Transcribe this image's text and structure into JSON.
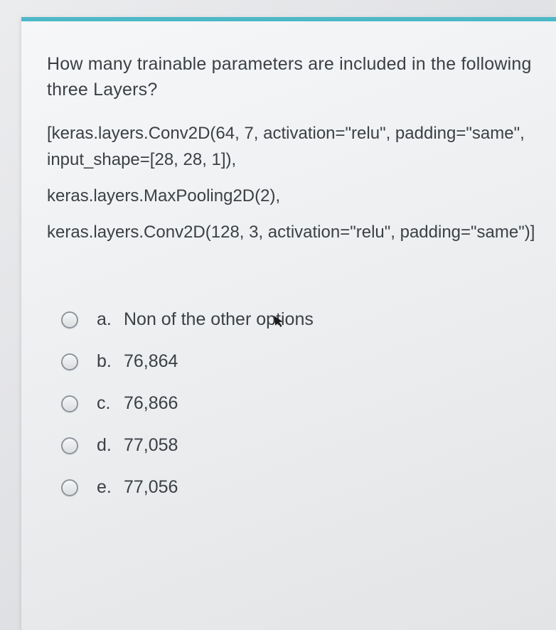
{
  "question": {
    "prompt": "How many trainable parameters are included in the following three Layers?",
    "code_lines": [
      "[keras.layers.Conv2D(64, 7, activation=\"relu\", padding=\"same\", input_shape=[28, 28, 1]),",
      " keras.layers.MaxPooling2D(2),",
      "keras.layers.Conv2D(128, 3, activation=\"relu\", padding=\"same\")]"
    ]
  },
  "options": [
    {
      "letter": "a.",
      "text": "Non of the other options"
    },
    {
      "letter": "b.",
      "text": "76,864"
    },
    {
      "letter": "c.",
      "text": "76,866"
    },
    {
      "letter": "d.",
      "text": "77,058"
    },
    {
      "letter": "e.",
      "text": "77,056"
    }
  ]
}
